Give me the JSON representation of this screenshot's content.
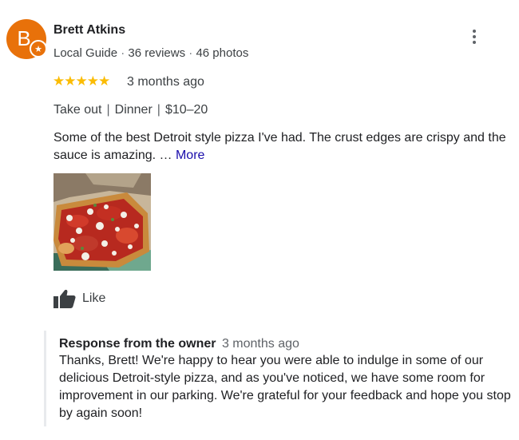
{
  "reviewer": {
    "name": "Brett Atkins",
    "avatar_letter": "B",
    "avatar_color": "#e8710a",
    "badge_glyph": "★",
    "badge": "Local Guide",
    "reviews": "36 reviews",
    "photos": "46 photos",
    "separator": "·"
  },
  "more_options_icon": "vertical-dots-icon",
  "rating": {
    "value": 5,
    "max": 5,
    "stars_text": "★★★★★",
    "star_color": "#fbbc04"
  },
  "time_ago": "3 months ago",
  "tags": {
    "service": "Take out",
    "meal": "Dinner",
    "price": "$10–20",
    "separator": "|"
  },
  "review": {
    "text": "Some of the best Detroit style pizza I've had. The crust edges are crispy and the sauce is amazing. …",
    "more_label": "More",
    "link_color": "#1a0dab"
  },
  "photo": {
    "icon": "review-photo",
    "count": 1
  },
  "like": {
    "label": "Like",
    "icon": "thumbs-up-icon"
  },
  "owner_response": {
    "title": "Response from the owner",
    "time_ago": "3 months ago",
    "text": "Thanks, Brett! We're happy to hear you were able to indulge in some of our delicious Detroit-style pizza, and as you've noticed, we have some room for improvement in our parking. We're grateful for your feedback and hope you stop by again soon!"
  }
}
